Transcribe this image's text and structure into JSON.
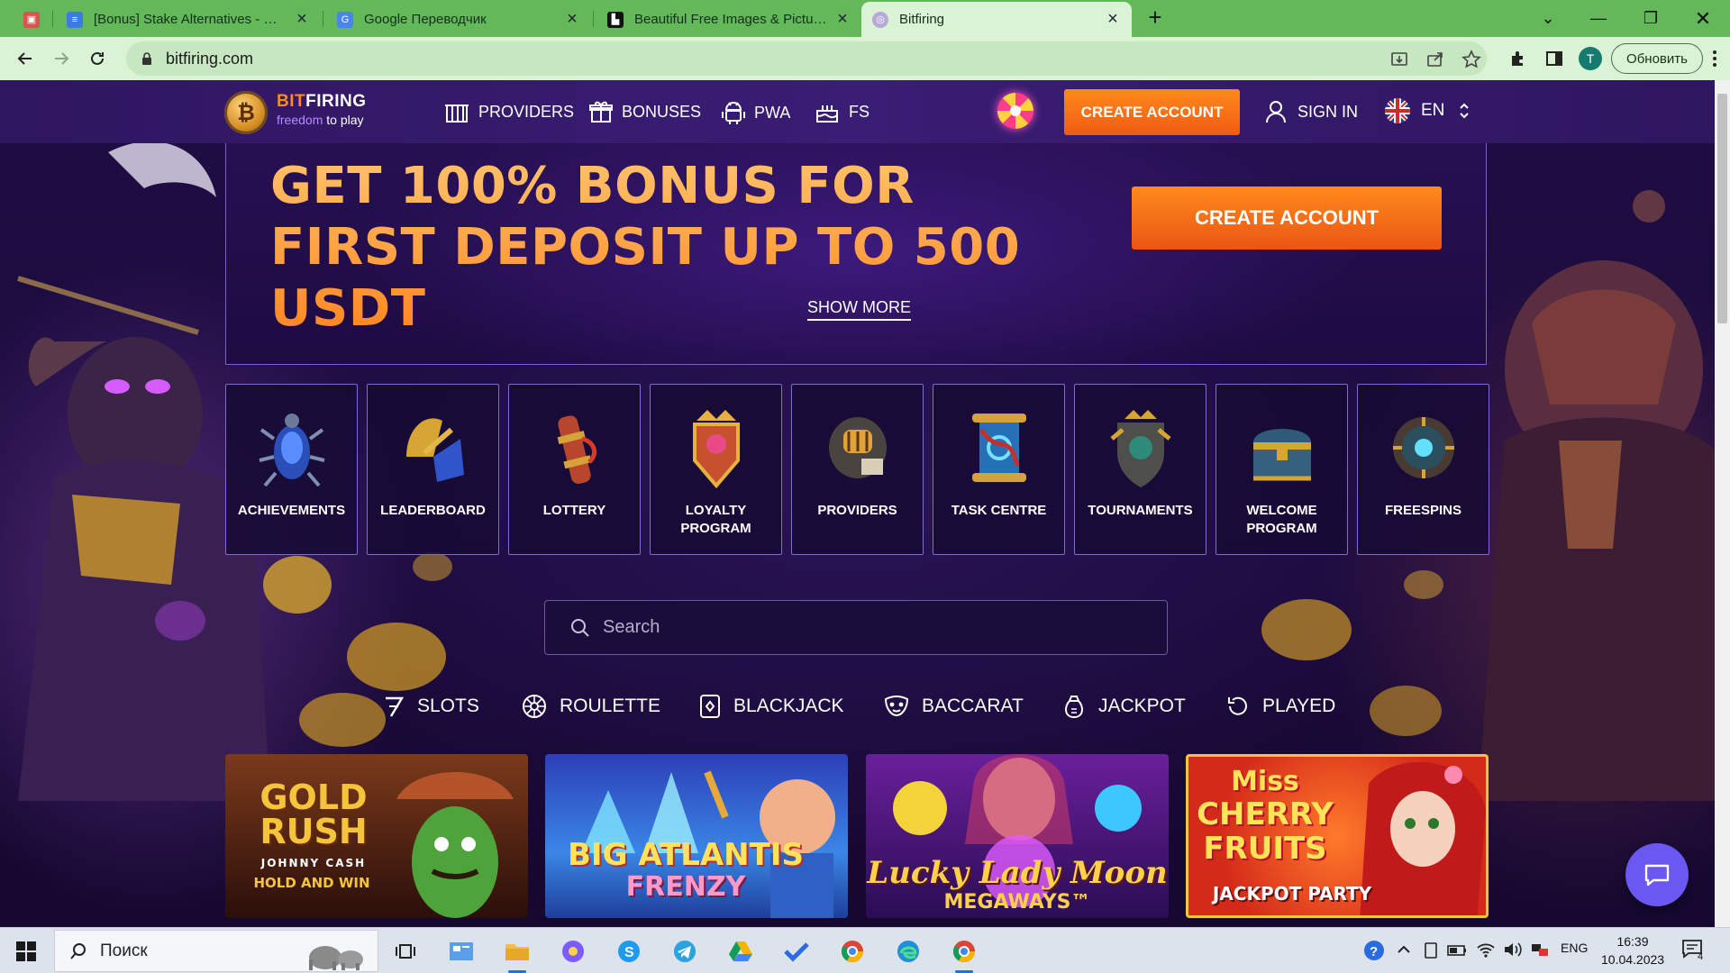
{
  "browser": {
    "tabs": [
      {
        "title": "",
        "favicon": "pinned-app-icon"
      },
      {
        "title": "[Bonus] Stake Alternatives - Goo",
        "favicon": "google-docs-icon"
      },
      {
        "title": "Google Переводчик",
        "favicon": "google-translate-icon"
      },
      {
        "title": "Beautiful Free Images & Pictures",
        "favicon": "unsplash-icon"
      },
      {
        "title": "Bitfiring",
        "favicon": "globe-icon",
        "active": true
      }
    ],
    "url": "bitfiring.com",
    "profile_initial": "T",
    "update_label": "Обновить"
  },
  "site": {
    "logo": {
      "brand_a": "BIT",
      "brand_b": "FIRING",
      "tag_a": "freedom",
      "tag_b": "to play",
      "coin_symbol": "₿"
    },
    "nav": [
      {
        "label": "PROVIDERS",
        "icon": "building-icon"
      },
      {
        "label": "BONUSES",
        "icon": "gift-icon"
      },
      {
        "label": "PWA",
        "icon": "android-icon"
      },
      {
        "label": "FS",
        "icon": "cake-icon"
      }
    ],
    "create_account": "CREATE ACCOUNT",
    "sign_in": "SIGN IN",
    "language": "EN"
  },
  "banner": {
    "title": "GET 100% BONUS FOR FIRST DEPOSIT UP TO 500 USDT",
    "cta": "CREATE ACCOUNT",
    "show_more": "SHOW MORE"
  },
  "features": [
    {
      "label": "ACHIEVEMENTS",
      "icon": "beetle-icon"
    },
    {
      "label": "LEADERBOARD",
      "icon": "horns-icon"
    },
    {
      "label": "LOTTERY",
      "icon": "scroll-icon"
    },
    {
      "label": "LOYALTY PROGRAM",
      "icon": "crest-icon"
    },
    {
      "label": "PROVIDERS",
      "icon": "helmet-icon"
    },
    {
      "label": "TASK CENTRE",
      "icon": "map-scroll-icon"
    },
    {
      "label": "TOURNAMENTS",
      "icon": "shield-icon"
    },
    {
      "label": "WELCOME PROGRAM",
      "icon": "chest-icon"
    },
    {
      "label": "FREESPINS",
      "icon": "orb-shield-icon"
    }
  ],
  "search": {
    "placeholder": "Search"
  },
  "categories": [
    {
      "label": "SLOTS",
      "icon": "seven-icon"
    },
    {
      "label": "ROULETTE",
      "icon": "roulette-icon"
    },
    {
      "label": "BLACKJACK",
      "icon": "card-icon"
    },
    {
      "label": "BACCARAT",
      "icon": "mask-icon"
    },
    {
      "label": "JACKPOT",
      "icon": "money-bag-icon"
    },
    {
      "label": "PLAYED",
      "icon": "history-icon"
    }
  ],
  "games": [
    {
      "title_a": "GOLD",
      "title_b": "RUSH",
      "sub": "JOHNNY CASH",
      "tag": "HOLD AND WIN"
    },
    {
      "title_a": "BIG ATLANTIS",
      "title_b": "FRENZY"
    },
    {
      "title_a": "Lucky Lady Moon",
      "title_b": "MEGAWAYS™"
    },
    {
      "title_a": "Miss",
      "title_b": "CHERRY",
      "title_c": "FRUITS",
      "tag": "JACKPOT PARTY"
    }
  ],
  "taskbar": {
    "search_placeholder": "Поиск",
    "lang": "ENG",
    "time": "16:39",
    "date": "10.04.2023",
    "notif_count": "4"
  },
  "colors": {
    "accent": "#ff7a1a",
    "brand_purple": "#3a1d74",
    "chrome_green": "#63b85a"
  }
}
